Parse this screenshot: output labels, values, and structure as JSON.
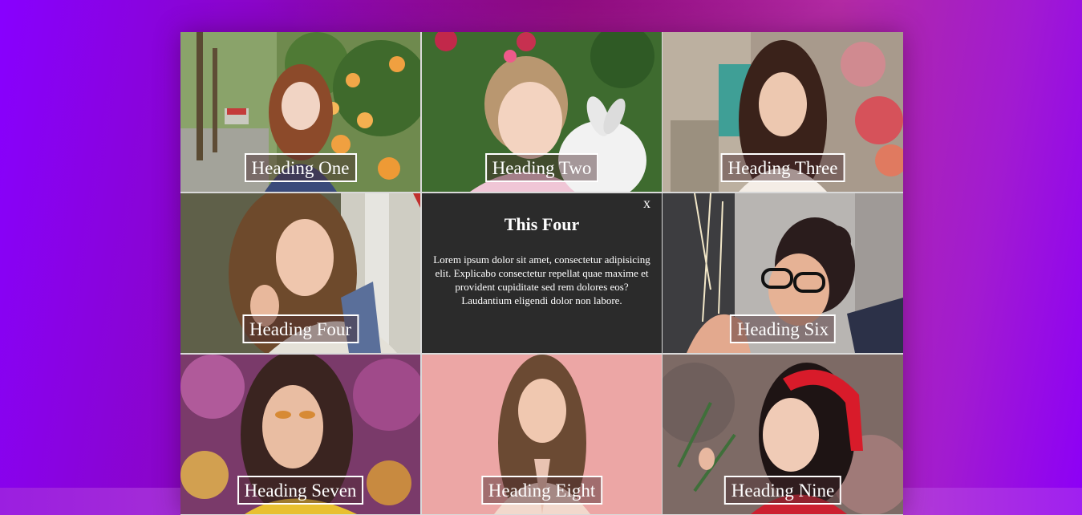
{
  "tiles": [
    {
      "heading": "Heading One"
    },
    {
      "heading": "Heading Two"
    },
    {
      "heading": "Heading Three"
    },
    {
      "heading": "Heading Four"
    },
    {
      "heading": "Heading Six"
    },
    {
      "heading": "Heading Seven"
    },
    {
      "heading": "Heading Eight"
    },
    {
      "heading": "Heading Nine"
    }
  ],
  "popup": {
    "close_label": "x",
    "title": "This Four",
    "text": "Lorem ipsum dolor sit amet, consectetur adipisicing elit. Explicabo consectetur repellat quae maxime et provident cupiditate sed rem dolores eos? Laudantium eligendi dolor non labore."
  }
}
